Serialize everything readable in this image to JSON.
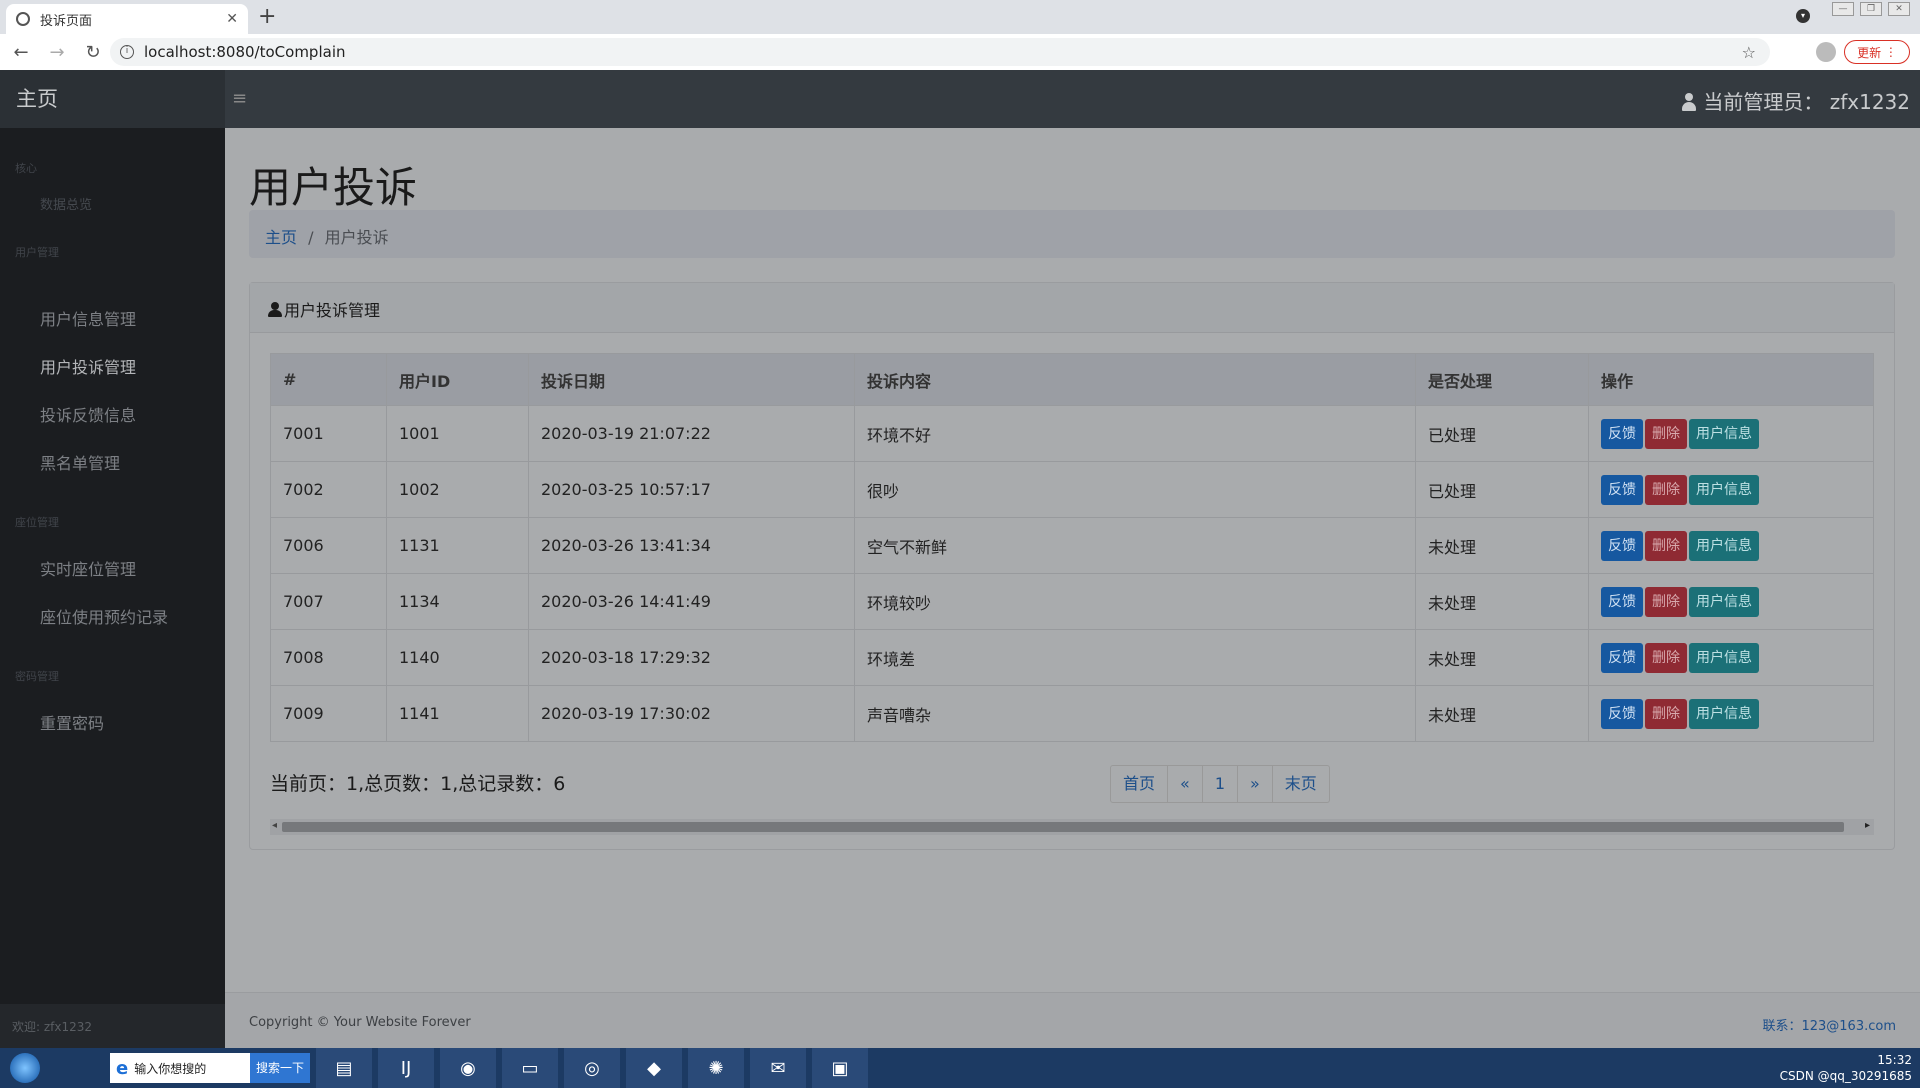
{
  "browser": {
    "tab_title": "投诉页面",
    "new_tab": "+",
    "url": "localhost:8080/toComplain",
    "update_label": "更新"
  },
  "navbar": {
    "brand": "主页",
    "toggle_icon": "≡",
    "admin_label": "当前管理员：",
    "admin_name": "zfx1232"
  },
  "sidebar": {
    "sections": [
      {
        "heading": "核心",
        "items": [
          {
            "label": "数据总览"
          }
        ]
      },
      {
        "heading": "用户管理",
        "items": [
          {
            "label": "用户信息管理"
          },
          {
            "label": "用户投诉管理"
          },
          {
            "label": "投诉反馈信息"
          },
          {
            "label": "黑名单管理"
          }
        ]
      },
      {
        "heading": "座位管理",
        "items": [
          {
            "label": "实时座位管理"
          },
          {
            "label": "座位使用预约记录"
          }
        ]
      },
      {
        "heading": "密码管理",
        "items": [
          {
            "label": "重置密码"
          }
        ]
      }
    ],
    "footer": "欢迎: zfx1232"
  },
  "main": {
    "title": "用户投诉",
    "breadcrumb": {
      "home": "主页",
      "separator": "/",
      "current": "用户投诉"
    },
    "card_title": "用户投诉管理",
    "table": {
      "headers": [
        "#",
        "用户ID",
        "投诉日期",
        "投诉内容",
        "是否处理",
        "操作"
      ],
      "rows": [
        {
          "id": "7001",
          "user_id": "1001",
          "date": "2020-03-19 21:07:22",
          "content": "环境不好",
          "status": "已处理"
        },
        {
          "id": "7002",
          "user_id": "1002",
          "date": "2020-03-25 10:57:17",
          "content": "很吵",
          "status": "已处理"
        },
        {
          "id": "7006",
          "user_id": "1131",
          "date": "2020-03-26 13:41:34",
          "content": "空气不新鲜",
          "status": "未处理"
        },
        {
          "id": "7007",
          "user_id": "1134",
          "date": "2020-03-26 14:41:49",
          "content": "环境较吵",
          "status": "未处理"
        },
        {
          "id": "7008",
          "user_id": "1140",
          "date": "2020-03-18 17:29:32",
          "content": "环境差",
          "status": "未处理"
        },
        {
          "id": "7009",
          "user_id": "1141",
          "date": "2020-03-19 17:30:02",
          "content": "声音嘈杂",
          "status": "未处理"
        }
      ],
      "actions": {
        "feedback": "反馈",
        "delete": "删除",
        "user_info": "用户信息"
      }
    },
    "page_info": "当前页：1,总页数：1,总记录数：6",
    "pager": {
      "first": "首页",
      "prev": "«",
      "page": "1",
      "next": "»",
      "last": "末页"
    }
  },
  "footer": {
    "copyright": "Copyright © Your Website Forever",
    "contact": "联系：123@163.com"
  },
  "taskbar": {
    "search_placeholder": "输入你想搜的",
    "search_button": "搜索一下",
    "clock_time": "15:32",
    "watermark": "CSDN @qq_30291685"
  }
}
